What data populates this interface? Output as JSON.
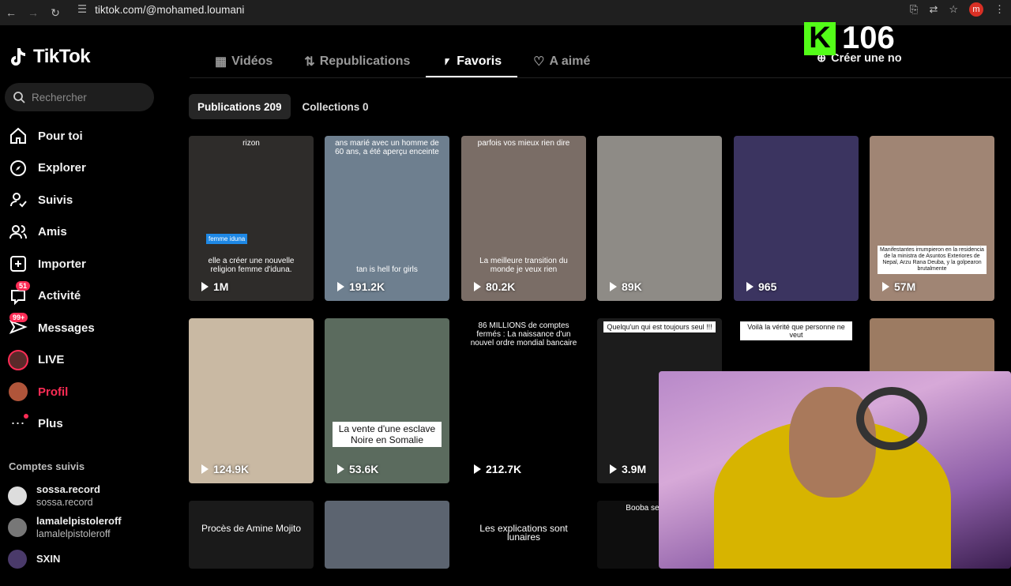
{
  "browser": {
    "url": "tiktok.com/@mohamed.loumani",
    "profile_initial": "m"
  },
  "app": {
    "logo_text": "TikTok",
    "search_placeholder": "Rechercher"
  },
  "nav": [
    {
      "label": "Pour toi",
      "icon": "home-icon",
      "badge": ""
    },
    {
      "label": "Explorer",
      "icon": "compass-icon",
      "badge": ""
    },
    {
      "label": "Suivis",
      "icon": "following-icon",
      "badge": ""
    },
    {
      "label": "Amis",
      "icon": "friends-icon",
      "badge": ""
    },
    {
      "label": "Importer",
      "icon": "upload-icon",
      "badge": ""
    },
    {
      "label": "Activité",
      "icon": "inbox-icon",
      "badge": "51"
    },
    {
      "label": "Messages",
      "icon": "messages-icon",
      "badge": "99+"
    },
    {
      "label": "LIVE",
      "icon": "live-icon",
      "badge": ""
    },
    {
      "label": "Profil",
      "icon": "profile-avatar",
      "badge": ""
    },
    {
      "label": "Plus",
      "icon": "more-icon",
      "badge": ""
    }
  ],
  "following": {
    "title": "Comptes suivis",
    "items": [
      {
        "name": "sossa.record",
        "handle": "sossa.record"
      },
      {
        "name": "lamalelpistoleroff",
        "handle": "lamalelpistoleroff"
      },
      {
        "name": "SXIN",
        "handle": ""
      }
    ]
  },
  "tabs": [
    {
      "label": "Vidéos",
      "icon": "grid-icon"
    },
    {
      "label": "Republications",
      "icon": "repost-icon"
    },
    {
      "label": "Favoris",
      "icon": "bookmark-icon"
    },
    {
      "label": "A aimé",
      "icon": "liked-icon"
    }
  ],
  "cta": {
    "label": "Créer une no"
  },
  "overlay": {
    "k_letter": "K",
    "count": "106"
  },
  "subtabs": {
    "publications": "Publications 209",
    "collections": "Collections 0"
  },
  "videos": [
    {
      "views": "1M",
      "caption": "elle a créer une nouvelle religion femme d'iduna.",
      "tag": "femme iduna",
      "top": "rizon",
      "bg": "#2e2c2a"
    },
    {
      "views": "191.2K",
      "caption": "tan is hell for girls",
      "top": "ans marié avec un homme de 60 ans, a été aperçu enceinte",
      "bg": "#6e7f8f"
    },
    {
      "views": "80.2K",
      "caption": "La meilleure transition du monde je veux rien",
      "top": "parfois vos mieux rien dire",
      "bg": "#7a6d66"
    },
    {
      "views": "89K",
      "caption": "",
      "top": "",
      "bg": "#8e8b86"
    },
    {
      "views": "965",
      "caption": "",
      "top": "",
      "bg": "#3b3460"
    },
    {
      "views": "57M",
      "caption": "Manifestantes irrumpieron en la residencia de la ministra de Asuntos Exteriores de Nepal, Arzu Rana Deuba, y la golpearon brutalmente",
      "top": "",
      "bg": "#a08574"
    },
    {
      "views": "124.9K",
      "caption": "",
      "top": "",
      "bg": "#c9b9a3"
    },
    {
      "views": "53.6K",
      "caption": "La vente d'une esclave Noire en Somalie",
      "top": "",
      "bg": "#5b6b5e"
    },
    {
      "views": "212.7K",
      "caption": "",
      "top": "86 MILLIONS de comptes fermés : La naissance d'un nouvel ordre mondial bancaire",
      "bg": "#000000"
    },
    {
      "views": "3.9M",
      "caption": "",
      "top": "Quelqu'un qui est toujours seul !!!",
      "bg": "#1c1c1c"
    },
    {
      "views": "",
      "caption": "",
      "top": "Voilà la vérité que personne ne veut",
      "bg": "#000000"
    },
    {
      "views": "",
      "caption": "",
      "top": "",
      "bg": "#9c7b62"
    },
    {
      "views": "",
      "caption": "",
      "top": "Procès de Amine Mojito",
      "bg": "#1a1a1a"
    },
    {
      "views": "",
      "caption": "",
      "top": "",
      "bg": "#5c6470"
    },
    {
      "views": "",
      "caption": "",
      "top": "Les explications sont lunaires",
      "bg": "#000000"
    },
    {
      "views": "",
      "caption": "",
      "top": "Booba se mo Rohff",
      "bg": "#0e0e0e"
    }
  ],
  "colors": {
    "accent": "#fe2c55",
    "kick_green": "#53fc18"
  }
}
